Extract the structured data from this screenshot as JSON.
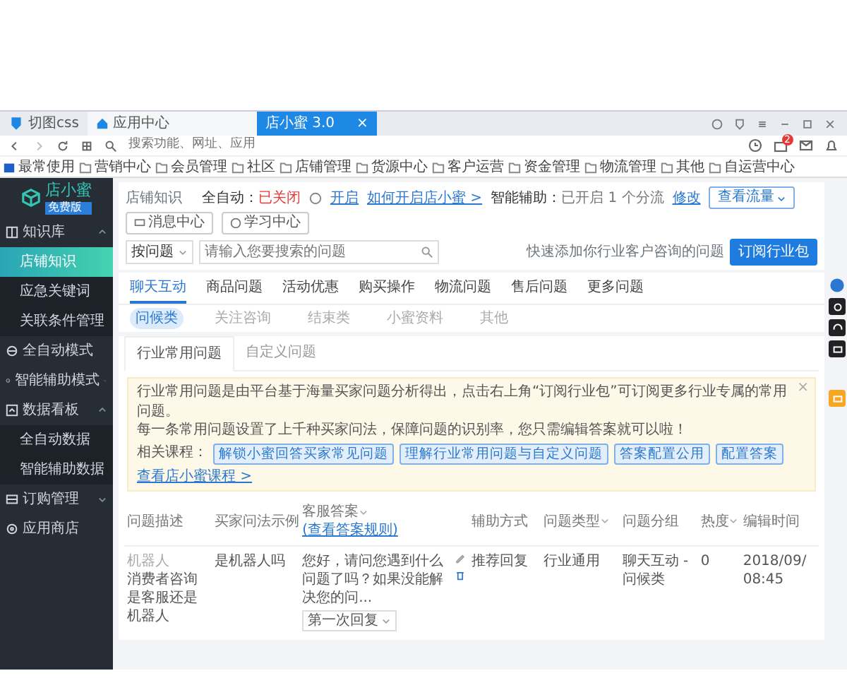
{
  "browser": {
    "tabs": [
      {
        "label": "切图css",
        "kind": "app",
        "selected": false
      },
      {
        "label": "应用中心",
        "kind": "home",
        "selected": false
      },
      {
        "label": "店小蜜 3.0",
        "kind": "page",
        "selected": true,
        "close": "×"
      }
    ],
    "address": {
      "placeholder": "搜索功能、网址、应用"
    },
    "notification_count": "2",
    "bookmarks": [
      {
        "label": "最常使用",
        "kind": "favorite"
      },
      {
        "label": "营销中心",
        "kind": "folder"
      },
      {
        "label": "会员管理",
        "kind": "folder"
      },
      {
        "label": "社区",
        "kind": "folder"
      },
      {
        "label": "店铺管理",
        "kind": "folder"
      },
      {
        "label": "货源中心",
        "kind": "folder"
      },
      {
        "label": "客户运营",
        "kind": "folder"
      },
      {
        "label": "资金管理",
        "kind": "folder"
      },
      {
        "label": "物流管理",
        "kind": "folder"
      },
      {
        "label": "其他",
        "kind": "folder"
      },
      {
        "label": "自运营中心",
        "kind": "folder"
      }
    ]
  },
  "sidebar": {
    "logo": "店小蜜",
    "edition": "免费版",
    "items": [
      {
        "label": "知识库",
        "kind": "group",
        "expanded": true,
        "children": [
          {
            "label": "店铺知识",
            "selected": true
          },
          {
            "label": "应急关键词",
            "selected": false
          },
          {
            "label": "关联条件管理",
            "selected": false
          }
        ]
      },
      {
        "label": "全自动模式",
        "kind": "link"
      },
      {
        "label": "智能辅助模式",
        "kind": "group",
        "expanded": false
      },
      {
        "label": "数据看板",
        "kind": "group",
        "expanded": true,
        "children": [
          {
            "label": "全自动数据",
            "selected": false
          },
          {
            "label": "智能辅助数据",
            "selected": false
          }
        ]
      },
      {
        "label": "订购管理",
        "kind": "group",
        "expanded": false
      },
      {
        "label": "应用商店",
        "kind": "link"
      }
    ]
  },
  "header": {
    "breadcrumb": "店铺知识",
    "auto": {
      "label": "全自动：",
      "value": "已关闭",
      "on": false
    },
    "enable_link": "开启",
    "help_link": "如何开启店小蜜 >",
    "assist": {
      "label": "智能辅助：",
      "value": "已开启 1 个分流",
      "on": true
    },
    "edit_link": "修改",
    "traffic_button": "查看流量",
    "message_center": "消息中心",
    "learning_center": "学习中心",
    "filter": {
      "value": "按问题"
    },
    "search": {
      "placeholder": "请输入您要搜索的问题"
    },
    "hint": "快速添加你行业客户咨询的问题",
    "subscribe_button": "订阅行业包"
  },
  "category_tabs": [
    {
      "label": "聊天互动",
      "selected": true
    },
    {
      "label": "商品问题",
      "selected": false
    },
    {
      "label": "活动优惠",
      "selected": false
    },
    {
      "label": "购买操作",
      "selected": false
    },
    {
      "label": "物流问题",
      "selected": false
    },
    {
      "label": "售后问题",
      "selected": false
    },
    {
      "label": "更多问题",
      "selected": false
    }
  ],
  "sub_tabs": [
    {
      "label": "问候类",
      "selected": true
    },
    {
      "label": "关注咨询",
      "selected": false
    },
    {
      "label": "结束类",
      "selected": false
    },
    {
      "label": "小蜜资料",
      "selected": false
    },
    {
      "label": "其他",
      "selected": false
    }
  ],
  "question_tabs": [
    {
      "label": "行业常用问题",
      "selected": true
    },
    {
      "label": "自定义问题",
      "selected": false
    }
  ],
  "notice": {
    "lines": [
      "行业常用问题是由平台基于海量买家问题分析得出，点击右上角“订阅行业包”可订阅更多行业专属的常用问题。",
      "每一条常用问题设置了上千种买家问法，保障问题的识别率，您只需编辑答案就可以啦！"
    ],
    "courses_label": "相关课程：",
    "courses": [
      "解锁小蜜回答买家常见问题",
      "理解行业常用问题与自定义问题",
      "答案配置公用",
      "配置答案"
    ],
    "more_courses": "查看店小蜜课程 >",
    "close": "×"
  },
  "table": {
    "columns": [
      {
        "label": "问题描述",
        "sortable": false
      },
      {
        "label": "买家问法示例",
        "sortable": false
      },
      {
        "label": "客服答案",
        "sortable": true,
        "link": "(查看答案规则)"
      },
      {
        "label": "辅助方式",
        "sortable": false
      },
      {
        "label": "问题类型",
        "sortable": true
      },
      {
        "label": "问题分组",
        "sortable": false
      },
      {
        "label": "热度",
        "sortable": true
      },
      {
        "label": "编辑时间",
        "sortable": false
      }
    ],
    "rows": [
      {
        "tag": "机器人",
        "description": "消费者咨询是客服还是机器人",
        "example": "是机器人吗",
        "answer": "您好，请问您遇到什么问题了吗？如果没能解决您的问...",
        "reply_select": "第一次回复",
        "assist": "推荐回复",
        "type": "行业通用",
        "group": "聊天互动 - 问候类",
        "heat": "0",
        "time": "2018/09/ 08:45"
      }
    ]
  }
}
